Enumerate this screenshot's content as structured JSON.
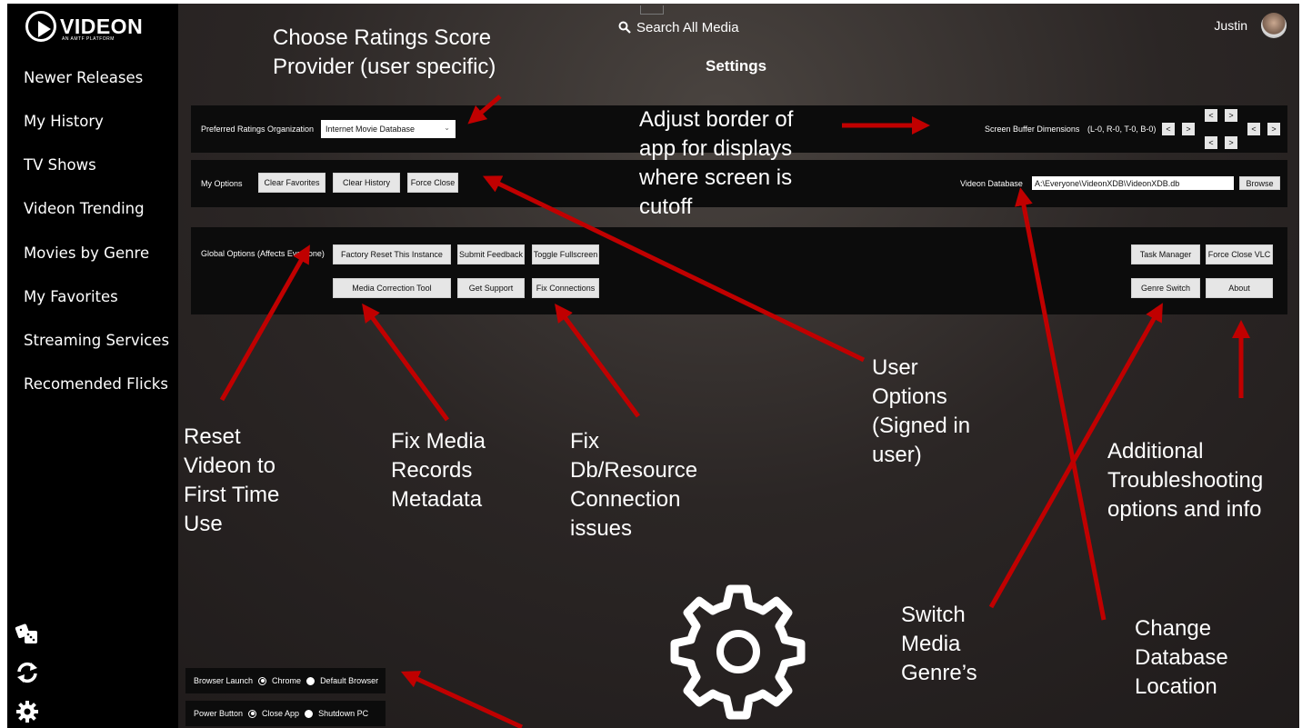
{
  "app": {
    "logo_text": "VIDEON",
    "logo_subtitle": "AN AMTF PLATFORM",
    "search_placeholder": "Search All Media",
    "user_name": "Justin",
    "page_title": "Settings"
  },
  "sidebar": {
    "items": [
      {
        "label": "Newer Releases"
      },
      {
        "label": "My History"
      },
      {
        "label": "TV Shows"
      },
      {
        "label": "Videon Trending"
      },
      {
        "label": "Movies by Genre"
      },
      {
        "label": "My Favorites"
      },
      {
        "label": "Streaming Services"
      },
      {
        "label": "Recomended Flicks"
      }
    ],
    "bottom_icons": [
      "dice-icon",
      "refresh-icon",
      "gear-icon"
    ]
  },
  "ratings": {
    "label": "Preferred Ratings Organization",
    "selected": "Internet Movie Database"
  },
  "screen_buffer": {
    "label": "Screen Buffer Dimensions",
    "values": "(L-0, R-0, T-0, B-0)",
    "left_dec": "<",
    "left_inc": ">",
    "top_dec": "<",
    "top_inc": ">",
    "bottom_dec": "<",
    "bottom_inc": ">",
    "right_dec": "<",
    "right_inc": ">"
  },
  "my_options": {
    "label": "My Options",
    "clear_favorites": "Clear Favorites",
    "clear_history": "Clear History",
    "force_close": "Force Close"
  },
  "database": {
    "label": "Videon Database",
    "path": "A:\\Everyone\\VideonXDB\\VideonXDB.db",
    "browse": "Browse"
  },
  "global_options": {
    "label": "Global Options (Affects Everyone)",
    "factory_reset": "Factory Reset This Instance",
    "submit_feedback": "Submit Feedback",
    "toggle_fullscreen": "Toggle Fullscreen",
    "media_correction": "Media Correction Tool",
    "get_support": "Get Support",
    "fix_connections": "Fix Connections",
    "task_manager": "Task Manager",
    "force_close_vlc": "Force Close VLC",
    "genre_switch": "Genre Switch",
    "about": "About"
  },
  "browser_launch": {
    "label": "Browser Launch",
    "option_chrome": "Chrome",
    "option_default": "Default Browser",
    "selected": "Chrome"
  },
  "power_button": {
    "label": "Power Button",
    "option_close": "Close App",
    "option_shutdown": "Shutdown PC",
    "selected": "Close App"
  },
  "annotations": {
    "ratings_provider": "Choose Ratings Score\nProvider (user specific)",
    "adjust_border": "Adjust border of\napp for displays\nwhere screen is\ncutoff",
    "user_options": "User\nOptions\n(Signed in\nuser)",
    "reset_videon": "Reset\nVideon to\nFirst Time\nUse",
    "fix_media": "Fix Media\nRecords\nMetadata",
    "fix_db": "Fix\nDb/Resource\nConnection\nissues",
    "troubleshooting": "Additional\nTroubleshooting\noptions and info",
    "switch_genre": "Switch\nMedia\nGenre’s",
    "change_db": "Change\nDatabase\nLocation"
  },
  "colors": {
    "arrow": "#c00000",
    "panel": "#0c0c0c",
    "button": "#e6e6e6"
  }
}
